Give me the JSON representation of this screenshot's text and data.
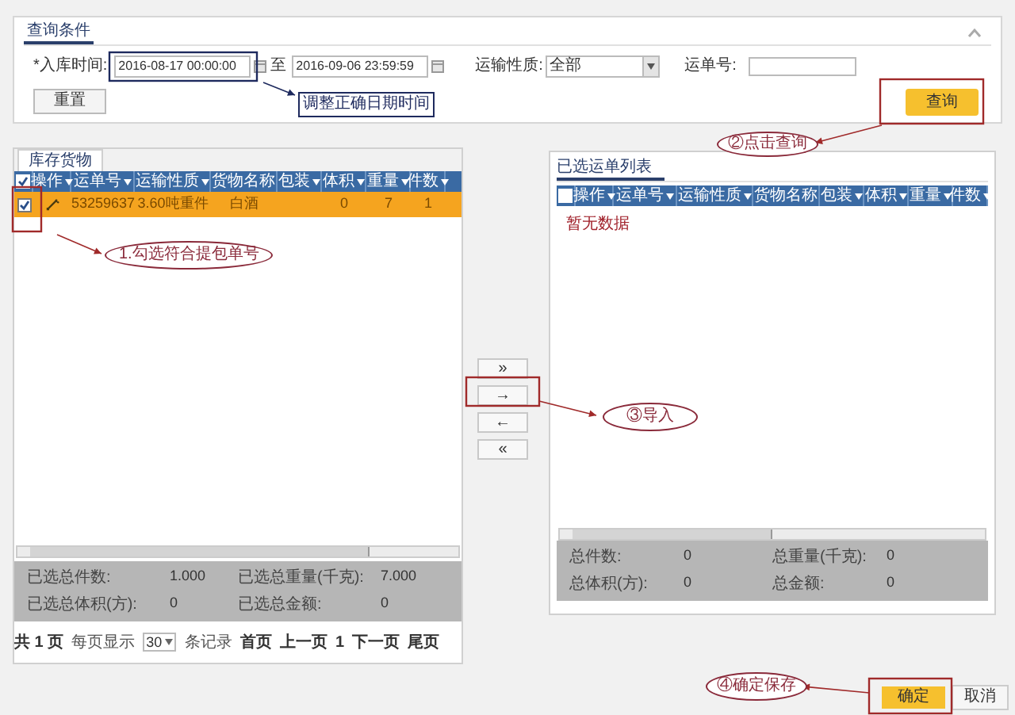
{
  "query": {
    "title": "查询条件",
    "date_label": "*入库时间:",
    "date_from": "2016-08-17 00:00:00",
    "date_separator": "至",
    "date_to": "2016-09-06 23:59:59",
    "transport_label": "运输性质:",
    "transport_value": "全部",
    "waybill_label": "运单号:",
    "reset_button": "重置",
    "query_button": "查询"
  },
  "stock_panel": {
    "tab": "库存货物",
    "header_checked": true,
    "columns": [
      {
        "label": "操作",
        "menu": true
      },
      {
        "label": "运单号",
        "menu": true
      },
      {
        "label": "运输性质",
        "menu": true
      },
      {
        "label": "货物名称",
        "menu": false
      },
      {
        "label": "包装",
        "menu": true
      },
      {
        "label": "体积",
        "menu": true
      },
      {
        "label": "重量",
        "menu": true
      },
      {
        "label": "件数",
        "menu": true
      }
    ],
    "rows": [
      {
        "selected": true,
        "checked": true,
        "cells": [
          "",
          "53259637",
          "3.60吨重件",
          "白酒",
          "",
          "0",
          "7",
          "1"
        ]
      }
    ],
    "summary": [
      {
        "label": "已选总件数:",
        "value": "1.000"
      },
      {
        "label": "已选总重量(千克):",
        "value": "7.000"
      },
      {
        "label": "已选总体积(方):",
        "value": "0"
      },
      {
        "label": "已选总金额:",
        "value": "0"
      }
    ],
    "pagination": {
      "total": "共 1 页",
      "per_page_label": "每页显示",
      "per_page": "30",
      "records_label": "条记录",
      "first": "首页",
      "prev": "上一页",
      "current": "1",
      "next": "下一页",
      "last": "尾页"
    }
  },
  "transfer_buttons": [
    "»",
    "→",
    "←",
    "«"
  ],
  "selected_panel": {
    "title": "已选运单列表",
    "header_checked": false,
    "columns": [
      {
        "label": "操作",
        "menu": true
      },
      {
        "label": "运单号",
        "menu": true
      },
      {
        "label": "运输性质",
        "menu": true
      },
      {
        "label": "货物名称",
        "menu": false
      },
      {
        "label": "包装",
        "menu": true
      },
      {
        "label": "体积",
        "menu": true
      },
      {
        "label": "重量",
        "menu": true
      },
      {
        "label": "件数",
        "menu": true
      }
    ],
    "empty_text": "暂无数据",
    "summary": [
      {
        "label": "总件数:",
        "value": "0"
      },
      {
        "label": "总重量(千克):",
        "value": "0"
      },
      {
        "label": "总体积(方):",
        "value": "0"
      },
      {
        "label": "总金额:",
        "value": "0"
      }
    ]
  },
  "footer_buttons": {
    "confirm": "确定",
    "cancel": "取消"
  },
  "annotations": {
    "date_hint": "调整正确日期时间",
    "query_hint": "②点击查询",
    "select_hint": "1.勾选符合提包单号",
    "import_hint": "③导入",
    "save_hint": "④确定保存"
  }
}
